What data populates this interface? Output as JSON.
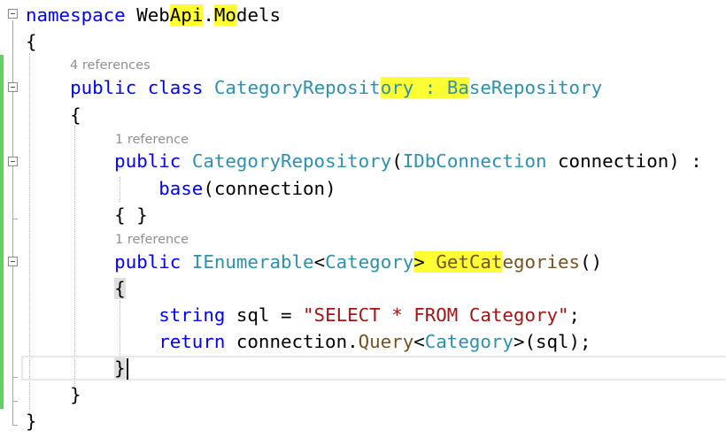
{
  "editor": {
    "colors": {
      "keyword": "#0000ff",
      "type": "#2b91af",
      "method": "#74531f",
      "string": "#a31515",
      "codelens": "#8f8f8f",
      "change_bar": "#5fd35f",
      "highlight": "#ffff33"
    },
    "icons": [
      "collapse-minus-icon"
    ],
    "codelens": [
      "4 references",
      "1 reference",
      "1 reference"
    ],
    "tokens": {
      "namespace": "namespace",
      "ns_web": "Web",
      "ns_api": "Api",
      "ns_dot": ".",
      "ns_mo": "Mo",
      "ns_dels": "dels",
      "open_ns": "{",
      "public1": "public",
      "class_kw": "class",
      "class_a": "CategoryReposit",
      "class_b": "ory : ",
      "class_c": "Ba",
      "class_d": "seRepository",
      "open_class": "{",
      "public2": "public",
      "ctor_name": "CategoryRepository",
      "ctor_paren": "(",
      "ctor_type": "IDbConnection",
      "ctor_rest": " connection) :",
      "base_kw": "base",
      "base_rest": "(connection)",
      "empty_body": "{ }",
      "public3": "public",
      "ienum": "IEnumerable",
      "lt": "<",
      "cat1": "Category",
      "gt_space": "> ",
      "getcat": "GetCat",
      "egories": "egories",
      "method_paren": "()",
      "open_method": "{",
      "string_kw": "string",
      "sql_assign": " sql = ",
      "sql_literal": "\"SELECT * FROM Category\"",
      "semi": ";",
      "return_kw": "return",
      "conn_dot": " connection.",
      "query": "Query",
      "lt2": "<",
      "cat2": "Category",
      "query_rest": ">(sql);",
      "close_method": "}",
      "close_class": "}",
      "close_ns": "}"
    }
  }
}
